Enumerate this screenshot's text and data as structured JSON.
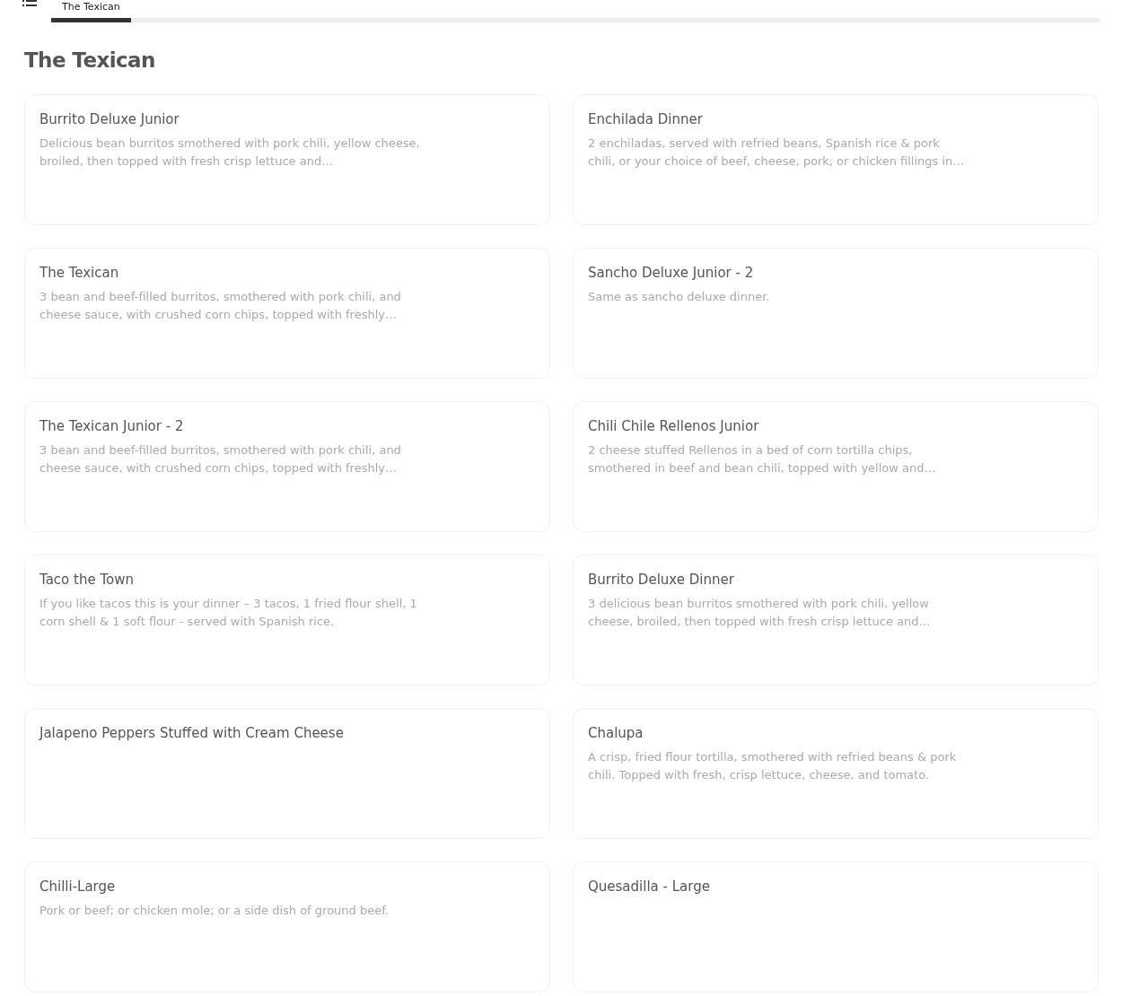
{
  "tabs": [
    {
      "label": "The Texican",
      "selected": true
    }
  ],
  "section": {
    "title": "The Texican"
  },
  "items": [
    {
      "name": "Burrito Deluxe Junior",
      "description": "Delicious bean burritos smothered with pork chili, yellow cheese, broiled, then topped with fresh crisp lettuce and…"
    },
    {
      "name": "Enchilada Dinner",
      "description": "2 enchiladas, served with refried beans, Spanish rice & pork chili, or your choice of beef, cheese, pork, or chicken fillings in…"
    },
    {
      "name": "The Texican",
      "description": "3 bean and beef-filled burritos, smothered with pork chili, and cheese sauce, with crushed corn chips, topped with freshly…"
    },
    {
      "name": "Sancho Deluxe Junior - 2",
      "description": "Same as sancho deluxe dinner."
    },
    {
      "name": "The Texican Junior - 2",
      "description": "3 bean and beef-filled burritos, smothered with pork chili, and cheese sauce, with crushed corn chips, topped with freshly…"
    },
    {
      "name": "Chili Chile Rellenos Junior",
      "description": "2 cheese stuffed Rellenos in a bed of corn tortilla chips, smothered in beef and bean chili, topped with yellow and…"
    },
    {
      "name": "Taco the Town",
      "description": "If you like tacos this is your dinner – 3 tacos, 1 fried flour shell, 1 corn shell & 1 soft flour - served with Spanish rice."
    },
    {
      "name": "Burrito Deluxe Dinner",
      "description": "3 delicious bean burritos smothered with pork chili, yellow cheese, broiled, then topped with fresh crisp lettuce and…"
    },
    {
      "name": "Jalapeno Peppers Stuffed with Cream Cheese"
    },
    {
      "name": "Chalupa",
      "description": "A crisp, fried flour tortilla, smothered with refried beans & pork chili. Topped with fresh, crisp lettuce, cheese, and tomato."
    },
    {
      "name": "Chilli-Large",
      "description": "Pork or beef; or chicken mole; or a side dish of ground beef."
    },
    {
      "name": "Quesadilla - Large"
    }
  ]
}
